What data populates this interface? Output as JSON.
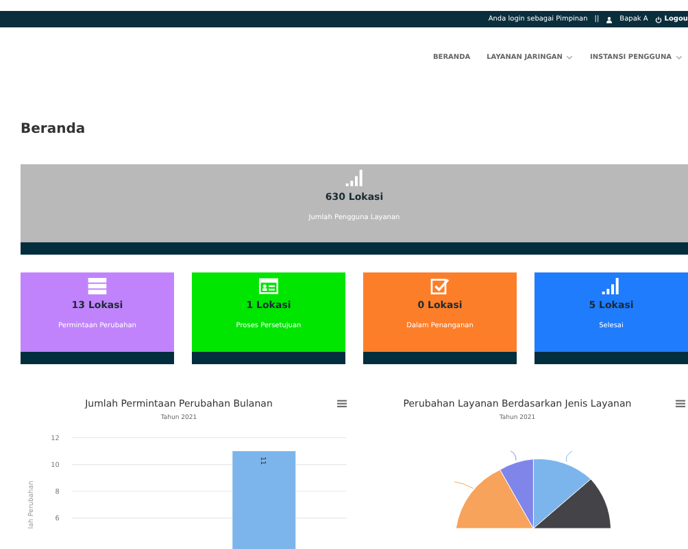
{
  "topbar": {
    "login_text": "Anda login sebagai Pimpinan",
    "separator": "||",
    "user": "Bapak A",
    "logout": "Logou"
  },
  "nav": [
    {
      "label": "BERANDA",
      "dropdown": false
    },
    {
      "label": "LAYANAN JARINGAN",
      "dropdown": true
    },
    {
      "label": "INSTANSI PENGGUNA",
      "dropdown": true
    }
  ],
  "page_title": "Beranda",
  "summary": {
    "kind": "signal",
    "value": "630 Lokasi",
    "label": "Jumlah Pengguna Layanan"
  },
  "stats": [
    {
      "kind": "server",
      "value": "13 Lokasi",
      "label": "Permintaan Perubahan",
      "color": "#c183fb"
    },
    {
      "kind": "idcard",
      "value": "1 Lokasi",
      "label": "Proses Persetujuan",
      "color": "#00e600"
    },
    {
      "kind": "check",
      "value": "0 Lokasi",
      "label": "Dalam Penanganan",
      "color": "#fd7e28"
    },
    {
      "kind": "signal",
      "value": "5 Lokasi",
      "label": "Selesai",
      "color": "#1f7cfc"
    }
  ],
  "bar_chart": {
    "title": "Jumlah Permintaan Perubahan Bulanan",
    "subtitle": "Tahun 2021",
    "chart_data": {
      "type": "bar",
      "ylabel": "lah Perubahan",
      "values": [
        null,
        null,
        null,
        11,
        null
      ],
      "yticks": [
        6,
        8,
        10,
        12
      ],
      "ylim": [
        0,
        12
      ],
      "grid": true,
      "data_labels": true
    }
  },
  "pie_chart": {
    "title": "Perubahan Layanan Berdasarkan Jenis Layanan",
    "subtitle": "Tahun 2021"
  }
}
